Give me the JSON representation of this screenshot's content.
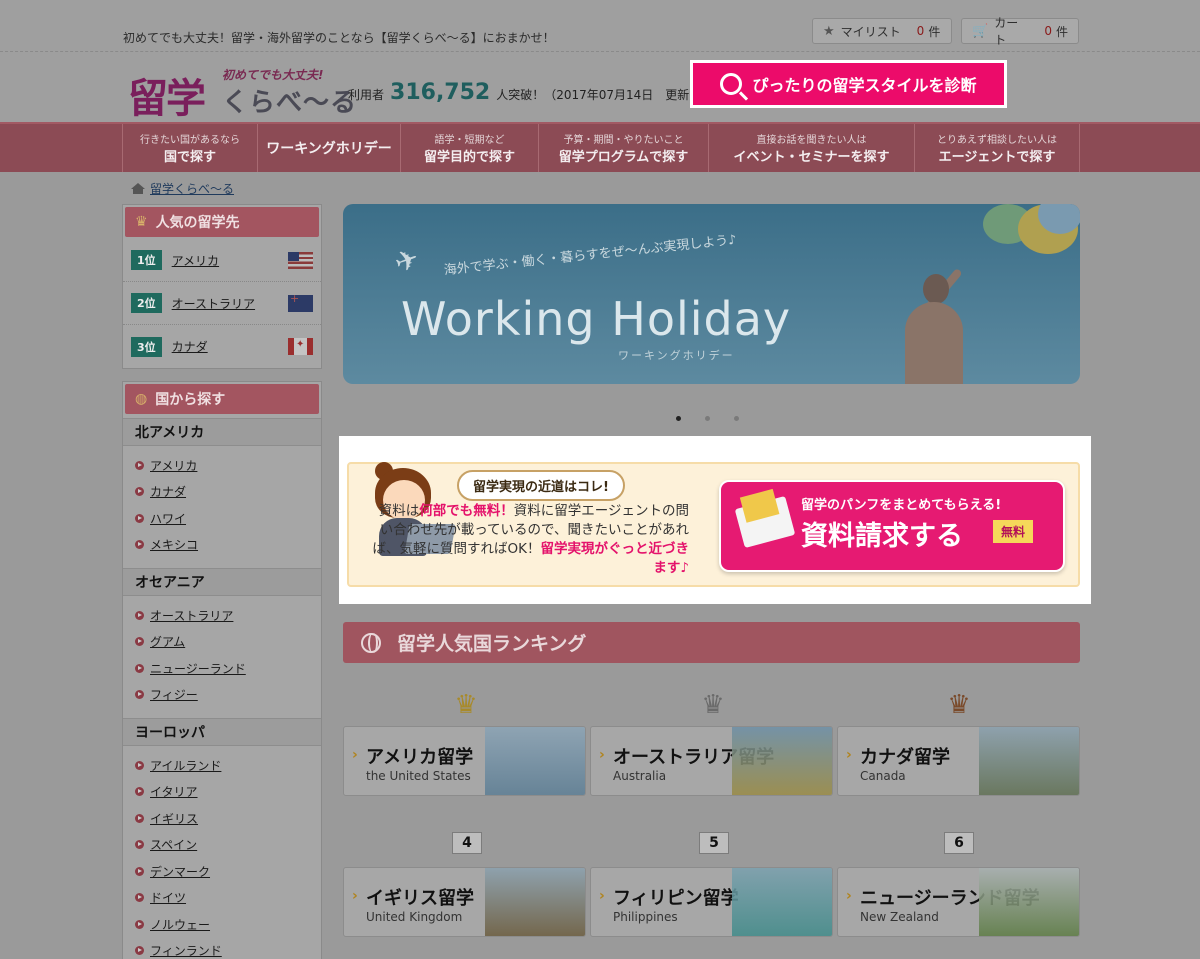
{
  "topbar": {
    "tagline": "初めてでも大丈夫！留学・海外留学のことなら【留学くらべ～る】におまかせ！",
    "mylist": {
      "label": "マイリスト",
      "count": "0",
      "unit": "件"
    },
    "cart": {
      "label": "カート",
      "count": "0",
      "unit": "件"
    }
  },
  "header": {
    "logo_main": "留学",
    "logo_sub": "初めてでも大丈夫!",
    "logo_kana": "くらべ〜る",
    "users_prefix": "利用者",
    "users_count": "316,752",
    "users_suffix": "人突破！（2017年07月14日　更新）",
    "diagnose_button": "ぴったりの留学スタイルを診断"
  },
  "gnav": [
    {
      "small": "行きたい国があるなら",
      "big": "国で探す"
    },
    {
      "small": "",
      "big": "ワーキングホリデー"
    },
    {
      "small": "語学・短期など",
      "big": "留学目的で探す"
    },
    {
      "small": "予算・期間・やりたいこと",
      "big": "留学プログラムで探す"
    },
    {
      "small": "直接お話を聞きたい人は",
      "big": "イベント・セミナーを探す"
    },
    {
      "small": "とりあえず相談したい人は",
      "big": "エージェントで探す"
    }
  ],
  "breadcrumb": {
    "home": "留学くらべ～る"
  },
  "sidebar": {
    "popular": {
      "title": "人気の留学先",
      "items": [
        {
          "rank": "1位",
          "name": "アメリカ"
        },
        {
          "rank": "2位",
          "name": "オーストラリア"
        },
        {
          "rank": "3位",
          "name": "カナダ"
        }
      ]
    },
    "by_country": {
      "title": "国から探す",
      "regions": [
        {
          "name": "北アメリカ",
          "countries": [
            "アメリカ",
            "カナダ",
            "ハワイ",
            "メキシコ"
          ]
        },
        {
          "name": "オセアニア",
          "countries": [
            "オーストラリア",
            "グアム",
            "ニュージーランド",
            "フィジー"
          ]
        },
        {
          "name": "ヨーロッパ",
          "countries": [
            "アイルランド",
            "イタリア",
            "イギリス",
            "スペイン",
            "デンマーク",
            "ドイツ",
            "ノルウェー",
            "フィンランド"
          ]
        }
      ]
    }
  },
  "hero": {
    "catch": "海外で学ぶ・働く・暮らすをぜ〜んぶ実現しよう♪",
    "title": "Working Holiday",
    "sub": "ワーキングホリデー"
  },
  "cta": {
    "bubble": "留学実現の近道はコレ!",
    "text_1": "資料は",
    "text_pink_1": "何部でも無料！",
    "text_2": "資料に留学エージェントの問い合わせ先が載っているので、聞きたいことがあれば、気軽に質問すればOK！",
    "text_pink_2": "留学実現がぐっと近づきます♪",
    "button_lead": "留学のパンフをまとめてもらえる!",
    "button_main": "資料請求する",
    "button_free": "無料"
  },
  "ranking": {
    "title": "留学人気国ランキング",
    "numbers": [
      "4",
      "5",
      "6"
    ],
    "items": [
      {
        "jp": "アメリカ留学",
        "en": "the United States"
      },
      {
        "jp": "オーストラリア留学",
        "en": "Australia"
      },
      {
        "jp": "カナダ留学",
        "en": "Canada"
      },
      {
        "jp": "イギリス留学",
        "en": "United Kingdom"
      },
      {
        "jp": "フィリピン留学",
        "en": "Philippines"
      },
      {
        "jp": "ニュージーランド留学",
        "en": "New Zealand"
      }
    ]
  }
}
